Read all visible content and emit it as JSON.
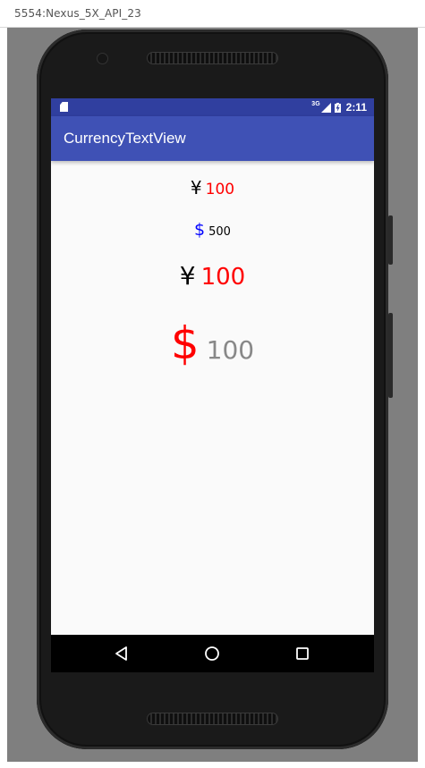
{
  "window": {
    "title": "5554:Nexus_5X_API_23"
  },
  "status_bar": {
    "network_type": "3G",
    "time": "2:11"
  },
  "app_bar": {
    "title": "CurrencyTextView"
  },
  "currency_views": [
    {
      "symbol": "¥",
      "amount": "100",
      "symbol_color": "#000000",
      "amount_color": "#ff0000"
    },
    {
      "symbol": "$",
      "amount": "500",
      "symbol_color": "#0000ff",
      "amount_color": "#000000"
    },
    {
      "symbol": "¥",
      "amount": "100",
      "symbol_color": "#000000",
      "amount_color": "#ff0000"
    },
    {
      "symbol": "$",
      "amount": "100",
      "symbol_color": "#ff0000",
      "amount_color": "#888888"
    }
  ],
  "navigation": {
    "back": "back-icon",
    "home": "home-icon",
    "recents": "recents-icon"
  },
  "colors": {
    "primary": "#3f51b5",
    "primary_dark": "#303f9f",
    "screen_background": "#fafafa"
  }
}
